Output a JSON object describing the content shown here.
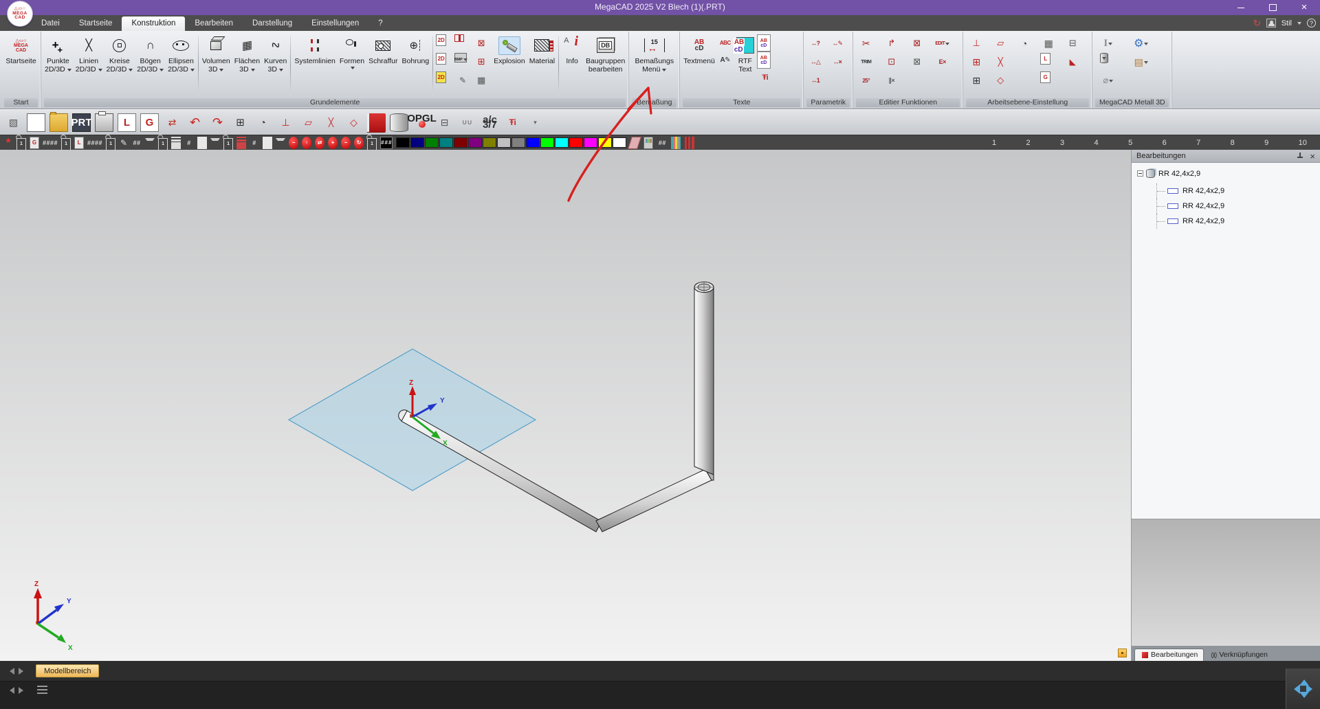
{
  "window": {
    "title": "MegaCAD 2025 V2 Blech (1)(.PRT)",
    "logo_lines": [
      "△▭○",
      "MEGA",
      "CAD"
    ]
  },
  "menubar": {
    "tabs": [
      {
        "label": "Datei"
      },
      {
        "label": "Startseite"
      },
      {
        "label": "Konstruktion",
        "active": true
      },
      {
        "label": "Bearbeiten"
      },
      {
        "label": "Darstellung"
      },
      {
        "label": "Einstellungen"
      },
      {
        "label": "?"
      }
    ],
    "style_label": "Stil"
  },
  "ribbon": {
    "start": {
      "group_label": "Start",
      "startseite": "Startseite"
    },
    "grundelemente": {
      "group_label": "Grundelemente",
      "punkte": {
        "l1": "Punkte",
        "l2": "2D/3D"
      },
      "linien": {
        "l1": "Linien",
        "l2": "2D/3D"
      },
      "kreise": {
        "l1": "Kreise",
        "l2": "2D/3D"
      },
      "boegen": {
        "l1": "Bögen",
        "l2": "2D/3D"
      },
      "ellipsen": {
        "l1": "Ellipsen",
        "l2": "2D/3D"
      },
      "volumen": {
        "l1": "Volumen",
        "l2": "3D"
      },
      "flaechen": {
        "l1": "Flächen",
        "l2": "3D"
      },
      "kurven": {
        "l1": "Kurven",
        "l2": "3D"
      },
      "systemlinien": {
        "l1": "Systemlinien"
      },
      "formen": {
        "l1": "Formen"
      },
      "schraffur": {
        "l1": "Schraffur"
      },
      "bohrung": {
        "l1": "Bohrung"
      },
      "explosion": {
        "l1": "Explosion"
      },
      "material": {
        "l1": "Material"
      },
      "info": {
        "l1": "Info"
      },
      "baugruppen": {
        "l1": "Baugruppen",
        "l2": "bearbeiten"
      },
      "grid": [
        {
          "n": "copy-2d-icon",
          "cls": "pgdoc2",
          "g": "2D"
        },
        {
          "n": "section-box-icon",
          "cls": "redbox"
        },
        {
          "n": "hide-elements-icon",
          "g": "⊠",
          "c": "#b22",
          "fs": 13
        },
        {
          "n": "copy-2d-red-icon",
          "cls": "pgdoc2",
          "g": "2D"
        },
        {
          "n": "bmp-export-icon",
          "cls": "bmpic",
          "g": "BMP",
          "crt": 1
        },
        {
          "n": "layer-add-icon",
          "g": "⊞",
          "c": "#b22",
          "fs": 13
        },
        {
          "n": "export-2d-yellow-icon",
          "cls": "pgdoc2 yel",
          "g": "2D"
        },
        {
          "n": "screenshot-pencil-icon",
          "g": "✎",
          "c": "#555",
          "fs": 12
        },
        {
          "n": "pixel-grid-icon",
          "g": "▦",
          "c": "#555",
          "fs": 13
        }
      ]
    },
    "bemassung": {
      "group_label": "Bemaßung",
      "menu": {
        "l1": "Bemaßungs",
        "l2": "Menü"
      }
    },
    "texte": {
      "group_label": "Texte",
      "textmenu": {
        "l1": "Textmenü"
      },
      "rtf": {
        "l1": "RTF",
        "l2": "Text"
      },
      "side1": [
        {
          "n": "text-label-icon",
          "g": "ABC",
          "cls": "tx",
          "c": "#b22",
          "fs": 8
        },
        {
          "n": "text-edit-icon",
          "g": "A✎",
          "cls": "tx",
          "c": "#333",
          "fs": 10
        }
      ],
      "side2": [
        {
          "n": "text-style-1-icon",
          "cls": "abcd-sm"
        },
        {
          "n": "text-style-2-icon",
          "cls": "abcd-sm"
        },
        {
          "n": "text-pin-icon",
          "g": "Ŧi",
          "c": "#b22",
          "fs": 11,
          "cls": "tx"
        }
      ]
    },
    "parametrik": {
      "group_label": "Parametrik",
      "grid": [
        {
          "n": "dim-query-icon",
          "g": "↔?",
          "cls": "dim"
        },
        {
          "n": "dim-edit-icon",
          "g": "↔✎",
          "cls": "dim"
        },
        {
          "n": "dim-shapes-icon",
          "g": "↔△",
          "cls": "dim"
        },
        {
          "n": "dim-delete-icon",
          "g": "↔×",
          "cls": "dim"
        },
        {
          "n": "dim-number-icon",
          "g": "↔1",
          "cls": "dim"
        }
      ]
    },
    "editier": {
      "group_label": "Editier Funktionen",
      "grid": [
        {
          "n": "scissors-icon",
          "g": "✂",
          "c": "#a22",
          "fs": 14
        },
        {
          "n": "stretch-icon",
          "g": "↱",
          "c": "#a22",
          "fs": 13
        },
        {
          "n": "delete-cross-icon",
          "g": "⊠",
          "c": "#a22",
          "fs": 13
        },
        {
          "n": "edit-menu-icon",
          "g": "EDIT",
          "cls": "tx",
          "c": "#a22",
          "fs": 7,
          "crt": 1
        },
        {
          "n": "trim-icon",
          "g": "TRIM",
          "cls": "tx",
          "c": "#333",
          "fs": 7
        },
        {
          "n": "copy-move-icon",
          "g": "⊡",
          "c": "#a22",
          "fs": 13
        },
        {
          "n": "delete-double-icon",
          "g": "⊠",
          "c": "#555",
          "fs": 13
        },
        {
          "n": "delete-e-icon",
          "g": "E×",
          "cls": "tx",
          "c": "#a22",
          "fs": 9
        },
        {
          "n": "rotate-25-icon",
          "g": "25°",
          "cls": "tx",
          "c": "#a22",
          "fs": 8
        },
        {
          "n": "tangent-icon",
          "g": "∥×",
          "cls": "tx",
          "c": "#555",
          "fs": 9
        }
      ]
    },
    "arbeitsebene": {
      "group_label": "Arbeitsebene-Einstellung",
      "grid": [
        {
          "n": "wp-standard-icon",
          "g": "⊥",
          "c": "#c22",
          "fs": 13
        },
        {
          "n": "wp-plane-icon",
          "g": "▱",
          "c": "#c22",
          "fs": 13
        },
        {
          "n": "wp-sphere-icon",
          "g": "◔",
          "c": "#333",
          "fs": 13
        },
        {
          "n": "wp-grid-icon",
          "g": "▦",
          "c": "#555",
          "fs": 14
        },
        {
          "n": "wp-tree-icon",
          "g": "⊟",
          "c": "#555",
          "fs": 13
        },
        {
          "n": "wp-cube-red-icon",
          "g": "⊞",
          "c": "#b22",
          "fs": 14
        },
        {
          "n": "wp-cross-icon",
          "g": "╳",
          "c": "#c22",
          "fs": 12
        },
        {
          "n": "spacer",
          "cls": "empty"
        },
        {
          "n": "wp-lpage-icon",
          "cls": "pgdoc2",
          "g": "L"
        },
        {
          "n": "wp-cone-icon",
          "g": "◣",
          "c": "#b22",
          "fs": 12
        },
        {
          "n": "wp-cube-icon",
          "g": "⊞",
          "c": "#333",
          "fs": 14
        },
        {
          "n": "wp-diamond-icon",
          "g": "◇",
          "c": "#c22",
          "fs": 13
        },
        {
          "n": "spacer",
          "cls": "empty"
        },
        {
          "n": "wp-gpage-icon",
          "cls": "pgdoc2",
          "g": "G"
        },
        {
          "n": "spacer",
          "cls": "empty"
        }
      ]
    },
    "metall": {
      "group_label": "MegaCAD Metall 3D",
      "items": [
        {
          "n": "steel-profile-icon",
          "g": "I",
          "cls": "serifI",
          "crt": 1
        },
        {
          "n": "gear-icon",
          "g": "⚙",
          "c": "#3a72c0",
          "fs": 16,
          "crt": 1
        },
        {
          "n": "pipe-icon",
          "cls": "cyl",
          "crt": 1
        },
        {
          "n": "wall-icon",
          "g": "▤",
          "c": "#b5762a",
          "fs": 14,
          "crt": 1
        },
        {
          "n": "bolt-icon",
          "g": "⌀",
          "c": "#888",
          "fs": 13,
          "crt": 1
        }
      ]
    }
  },
  "quick_toolbar": {
    "icons": [
      {
        "n": "abort-checker-icon",
        "g": "▧",
        "c": "#555",
        "fs": 14
      },
      {
        "n": "new-document-icon",
        "cls": "page"
      },
      {
        "n": "open-folder-icon",
        "cls": "folder"
      },
      {
        "n": "save-prt-icon",
        "cls": "floppy",
        "g": "PRT"
      },
      {
        "n": "print-icon",
        "cls": "printer"
      },
      {
        "n": "l-page-icon",
        "cls": "pgdoc2",
        "g": "L"
      },
      {
        "n": "g-page-icon",
        "cls": "pgdoc2",
        "g": "G"
      },
      {
        "n": "swap-pages-icon",
        "g": "⇄",
        "c": "#b32",
        "fs": 14
      },
      {
        "n": "undo-icon",
        "g": "↶",
        "c": "#c22",
        "fs": 18
      },
      {
        "n": "redo-icon",
        "g": "↷",
        "c": "#c22",
        "fs": 18
      },
      {
        "n": "workplane-cube-icon",
        "g": "⊞",
        "c": "#333",
        "fs": 15
      },
      {
        "n": "workplane-ball-icon",
        "g": "◔",
        "c": "#333",
        "fs": 14
      },
      {
        "n": "workplane-list-icon",
        "g": "⊥",
        "c": "#c22",
        "fs": 14
      },
      {
        "n": "workplane-plane-icon",
        "g": "▱",
        "c": "#c22",
        "fs": 14
      },
      {
        "n": "workplane-cross-icon",
        "g": "╳",
        "c": "#c22",
        "fs": 12
      },
      {
        "n": "workplane-up-icon",
        "g": "◇",
        "c": "#c22",
        "fs": 14
      },
      {
        "n": "assembly-book-icon",
        "cls": "book"
      },
      {
        "n": "cylinder-icon",
        "cls": "cyl"
      },
      {
        "n": "opengl-icon",
        "cls": "opgl",
        "g": "OPGL"
      },
      {
        "n": "structure-tree-icon",
        "g": "⊟",
        "c": "#555",
        "fs": 14
      },
      {
        "n": "paperclip-icon",
        "g": "∪∪",
        "c": "#555",
        "fs": 10
      },
      {
        "n": "fraction-icon",
        "cls": "frac",
        "g": "a/c 3/7"
      },
      {
        "n": "pin-info-icon",
        "g": "Ŧi",
        "c": "#c22",
        "cls": "tx",
        "fs": 12
      },
      {
        "n": "toolbar-more-icon",
        "g": "▾",
        "c": "#666",
        "fs": 9
      }
    ]
  },
  "statusbar": {
    "items_a": [
      {
        "n": "redraw-star-icon",
        "g": "*",
        "cls": "star"
      },
      {
        "n": "lock-icon",
        "cls": "lock",
        "g": "1"
      },
      {
        "n": "g-page-status-icon",
        "cls": "pgdoc2 dark",
        "g": "G"
      },
      {
        "n": "group-number-field",
        "cls": "field",
        "g": "####"
      },
      {
        "n": "lock-icon",
        "cls": "lock",
        "g": "1"
      },
      {
        "n": "l-page-status-icon",
        "cls": "pgdoc2 dark",
        "g": "L"
      },
      {
        "n": "layer-number-field",
        "cls": "field",
        "g": "####"
      },
      {
        "n": "lock-icon",
        "cls": "lock",
        "g": "1"
      },
      {
        "n": "pen-icon",
        "g": "✎",
        "c": "#e0e0e0",
        "fs": 12
      },
      {
        "n": "pen-number-field",
        "cls": "field",
        "g": "##"
      },
      {
        "n": "caret-down-icon",
        "cls": "chev"
      },
      {
        "n": "lock-icon",
        "cls": "lock",
        "g": "1"
      },
      {
        "n": "line-width-icon",
        "cls": "lw"
      },
      {
        "n": "line-width-field",
        "cls": "field",
        "g": "#"
      },
      {
        "n": "line-width-preview",
        "cls": "hline"
      },
      {
        "n": "caret-down-icon",
        "cls": "chev"
      },
      {
        "n": "lock-icon",
        "cls": "lock",
        "g": "1"
      },
      {
        "n": "line-type-icon",
        "cls": "lt"
      },
      {
        "n": "line-type-field",
        "cls": "field",
        "g": "#"
      },
      {
        "n": "line-type-preview",
        "cls": "hline"
      },
      {
        "n": "caret-down-icon",
        "cls": "chev"
      },
      {
        "n": "zoom-out-icon",
        "cls": "mag",
        "g": "−"
      },
      {
        "n": "zoom-window-icon",
        "cls": "mag",
        "g": "▫"
      },
      {
        "n": "zoom-pan-icon",
        "cls": "mag",
        "g": "⇄"
      },
      {
        "n": "zoom-in-icon",
        "cls": "mag",
        "g": "+"
      },
      {
        "n": "zoom-minus-icon",
        "cls": "mag",
        "g": "−"
      },
      {
        "n": "zoom-previous-icon",
        "cls": "mag",
        "g": "↻"
      },
      {
        "n": "lock-icon",
        "cls": "lock",
        "g": "1"
      },
      {
        "n": "current-color-swatch",
        "cls": "cursw",
        "g": "###"
      }
    ],
    "palette": [
      "#000000",
      "#000080",
      "#008000",
      "#008080",
      "#800000",
      "#800080",
      "#808000",
      "#c0c0c0",
      "#808080",
      "#0000ff",
      "#00ff00",
      "#00ffff",
      "#ff0000",
      "#ff00ff",
      "#ffff00",
      "#ffffff"
    ],
    "items_b": [
      {
        "n": "eraser-icon",
        "cls": "eraser"
      },
      {
        "n": "monitor-icon",
        "cls": "monitor"
      },
      {
        "n": "hatch-field",
        "cls": "field",
        "g": "##"
      },
      {
        "n": "layer-columns-icon",
        "cls": "colsic"
      },
      {
        "n": "line-columns-icon",
        "cls": "colsic red"
      }
    ],
    "scale_numbers": [
      "1",
      "2",
      "3",
      "4",
      "5",
      "6",
      "7",
      "8",
      "9",
      "10"
    ]
  },
  "canvas": {
    "origin_axes": {
      "x": "X",
      "y": "Y",
      "z": "Z"
    },
    "world_axes": {
      "x": "X",
      "y": "Y",
      "z": "Z"
    }
  },
  "panel": {
    "header": "Bearbeitungen",
    "tree": {
      "root": "RR 42,4x2,9",
      "children": [
        {
          "label": "RR 42,4x2,9"
        },
        {
          "label": "RR 42,4x2,9"
        },
        {
          "label": "RR 42,4x2,9"
        }
      ]
    },
    "tabs": {
      "bearbeitungen": "Bearbeitungen",
      "verknuepfungen": "Verknüpfungen"
    }
  },
  "bottom": {
    "model_tab": "Modellbereich"
  },
  "annotation": {
    "color": "#d81f1f"
  }
}
